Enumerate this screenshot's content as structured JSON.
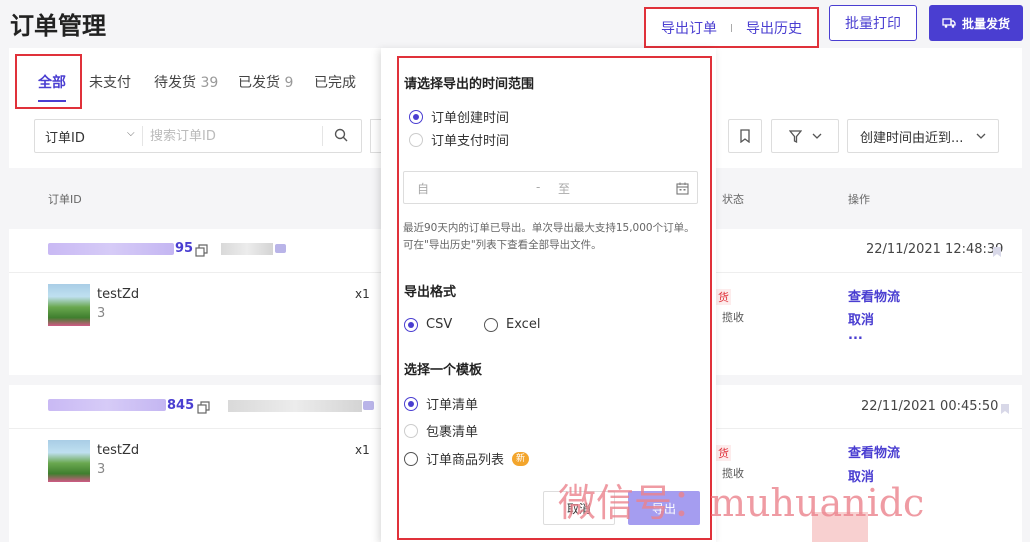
{
  "header": {
    "title": "订单管理",
    "export_order": "导出订单",
    "export_history": "导出历史",
    "batch_print": "批量打印",
    "batch_ship": "批量发货"
  },
  "tabs": [
    {
      "label": "全部",
      "count": ""
    },
    {
      "label": "未支付",
      "count": ""
    },
    {
      "label": "待发货",
      "count": "39"
    },
    {
      "label": "已发货",
      "count": "9"
    },
    {
      "label": "已完成",
      "count": ""
    }
  ],
  "filters": {
    "search_type": "订单ID",
    "search_placeholder": "搜索订单ID",
    "sort": "创建时间由近到..."
  },
  "table_headers": {
    "order_id": "订单ID",
    "status": "状态",
    "ops": "操作"
  },
  "orders": [
    {
      "id_suffix": "95",
      "time": "22/11/2021 12:48:39",
      "product": "testZd",
      "qty": "3",
      "x": "x1",
      "status_red": "货",
      "status_grey": "揽收",
      "ops": [
        "查看物流",
        "取消",
        "..."
      ]
    },
    {
      "id_suffix": "845",
      "time": "22/11/2021 00:45:50",
      "product": "testZd",
      "qty": "3",
      "x": "x1",
      "status_red": "货",
      "status_grey": "揽收",
      "ops": [
        "查看物流",
        "取消"
      ]
    }
  ],
  "export_panel": {
    "time_title": "请选择导出的时间范围",
    "time_options": [
      "订单创建时间",
      "订单支付时间"
    ],
    "date_from": "自",
    "date_dash": "-",
    "date_to": "至",
    "note": "最近90天内的订单已导出。单次导出最大支持15,000个订单。可在\"导出历史\"列表下查看全部导出文件。",
    "format_title": "导出格式",
    "format_options": [
      "CSV",
      "Excel"
    ],
    "template_title": "选择一个模板",
    "template_options": [
      "订单清单",
      "包裹清单",
      "订单商品列表"
    ],
    "new_badge": "新",
    "cancel": "取消",
    "confirm": "导出"
  },
  "watermark": "微信号：muhuanidc",
  "colors": {
    "accent": "#4a3ed1",
    "highlight": "#e0313a",
    "badge": "#f3a52c"
  }
}
